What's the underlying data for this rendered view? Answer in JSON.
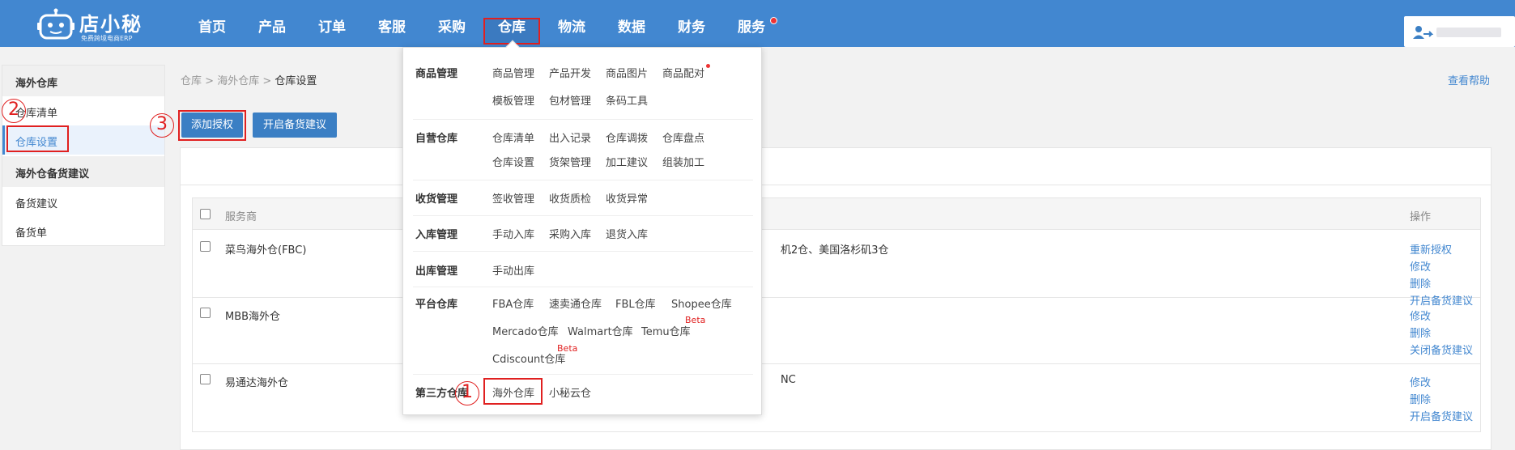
{
  "header": {
    "brand": "店小秘",
    "slogan": "免费跨境电商ERP",
    "nav": [
      "首页",
      "产品",
      "订单",
      "客服",
      "采购",
      "仓库",
      "物流",
      "数据",
      "财务",
      "服务"
    ],
    "active_nav": "仓库"
  },
  "sidebar": {
    "group1_title": "海外仓库",
    "group1_items": [
      "仓库清单",
      "仓库设置"
    ],
    "group2_title": "海外仓备货建议",
    "group2_items": [
      "备货建议",
      "备货单"
    ]
  },
  "breadcrumb": {
    "a": "仓库",
    "sep": ">",
    "b": "海外仓库",
    "c": "仓库设置"
  },
  "help": "查看帮助",
  "buttons": {
    "add_auth": "添加授权",
    "enable_stock": "开启备货建议"
  },
  "annotations": {
    "n1": "1",
    "n2": "2",
    "n3": "3"
  },
  "table": {
    "col_provider": "服务商",
    "col_ops": "操作",
    "rows": [
      {
        "provider": "菜鸟海外仓(FBC)",
        "warehouses": "机2仓、美国洛杉矶3仓",
        "ops": [
          "重新授权",
          "修改",
          "删除",
          "开启备货建议"
        ]
      },
      {
        "provider": "MBB海外仓",
        "warehouses": "",
        "ops": [
          "修改",
          "删除",
          "关闭备货建议"
        ]
      },
      {
        "provider": "易通达海外仓",
        "warehouses": "NC",
        "ops": [
          "修改",
          "删除",
          "开启备货建议"
        ]
      }
    ]
  },
  "dropdown": {
    "sections": [
      {
        "title": "商品管理",
        "lines": [
          [
            "商品管理",
            "产品开发",
            "商品图片",
            "商品配对"
          ],
          [
            "模板管理",
            "包材管理",
            "条码工具"
          ]
        ]
      },
      {
        "title": "自营仓库",
        "lines": [
          [
            "仓库清单",
            "出入记录",
            "仓库调拨",
            "仓库盘点"
          ],
          [
            "仓库设置",
            "货架管理",
            "加工建议",
            "组装加工"
          ]
        ]
      },
      {
        "title": "收货管理",
        "lines": [
          [
            "签收管理",
            "收货质检",
            "收货异常"
          ]
        ]
      },
      {
        "title": "入库管理",
        "lines": [
          [
            "手动入库",
            "采购入库",
            "退货入库"
          ]
        ]
      },
      {
        "title": "出库管理",
        "lines": [
          [
            "手动出库"
          ]
        ]
      },
      {
        "title": "平台仓库",
        "lines": [
          [
            "FBA仓库",
            "速卖通仓库",
            "FBL仓库",
            "Shopee仓库"
          ],
          [
            "Mercado仓库",
            "Walmart仓库",
            "Temu仓库"
          ],
          [
            "Cdiscount仓库"
          ]
        ]
      },
      {
        "title": "第三方仓库",
        "lines": [
          [
            "海外仓库",
            "小秘云仓"
          ]
        ]
      }
    ],
    "beta": "Beta"
  },
  "colors": {
    "topbar": "#4287d0",
    "accent": "#3b7fc4",
    "annotation": "#e02020"
  }
}
